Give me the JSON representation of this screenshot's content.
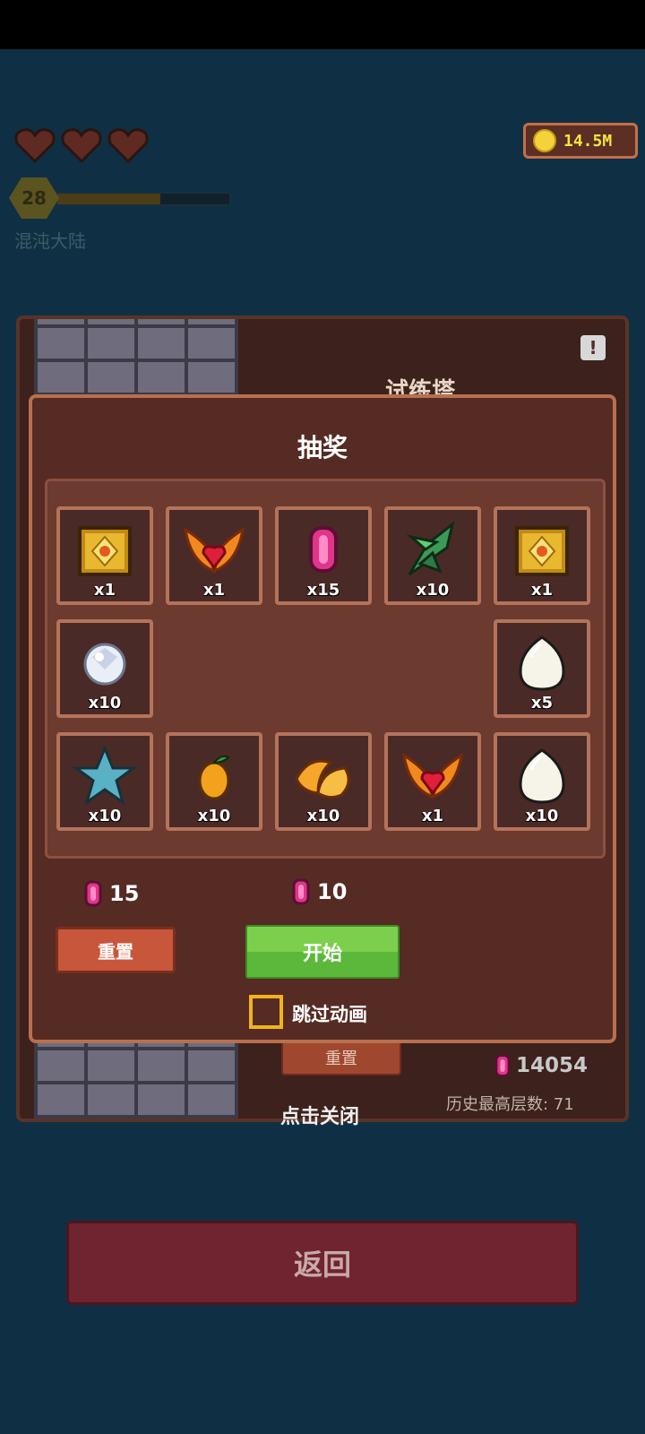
{
  "hud": {
    "hearts": 3,
    "level": "28",
    "xp_fraction": 0.6,
    "region": "混沌大陆",
    "coins": "14.5M"
  },
  "tower": {
    "title": "试练塔",
    "reset_label": "重置",
    "gem_total": "14054",
    "history_best": "历史最高层数: 71",
    "close_hint": "点击关闭"
  },
  "lottery": {
    "title": "抽奖",
    "slots": [
      {
        "icon": "golden-chest-icon",
        "qty": "x1"
      },
      {
        "icon": "winged-heart-icon",
        "qty": "x1"
      },
      {
        "icon": "pink-gem-icon",
        "qty": "x15"
      },
      {
        "icon": "green-leaf-icon",
        "qty": "x10"
      },
      {
        "icon": "golden-chest-icon",
        "qty": "x1"
      },
      {
        "icon": "crystal-orb-icon",
        "qty": "x10"
      },
      {
        "icon": "white-egg-icon",
        "qty": "x5"
      },
      {
        "icon": "blue-star-icon",
        "qty": "x10"
      },
      {
        "icon": "mango-icon",
        "qty": "x10"
      },
      {
        "icon": "orange-slices-icon",
        "qty": "x10"
      },
      {
        "icon": "winged-heart-icon",
        "qty": "x1"
      },
      {
        "icon": "white-egg-icon",
        "qty": "x10"
      }
    ],
    "reset_cost": "15",
    "reset_label": "重置",
    "start_cost": "10",
    "start_label": "开始",
    "skip_label": "跳过动画",
    "skip_checked": false
  },
  "back_label": "返回",
  "colors": {
    "accent_green": "#6cc444",
    "gem_pink": "#e0358a",
    "coin_yellow": "#f3e540"
  }
}
